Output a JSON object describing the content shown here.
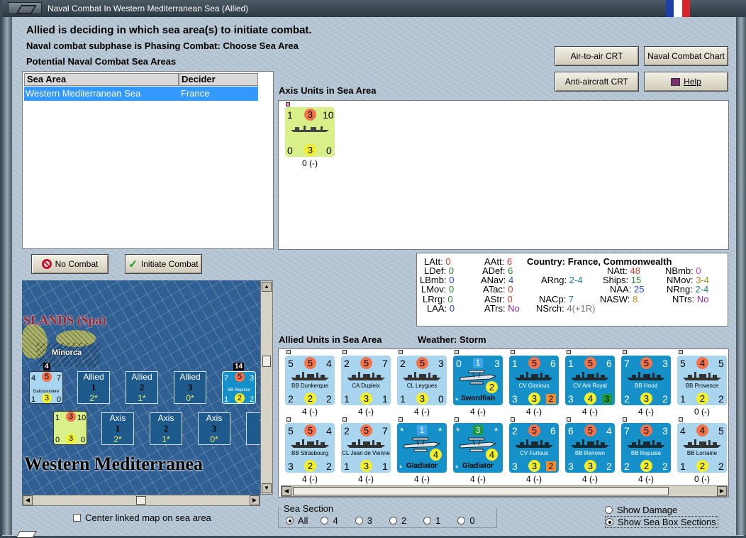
{
  "window": {
    "title": "Naval Combat In Western Mediterranean Sea (Allied)"
  },
  "header": {
    "line1": "Allied is deciding in which sea area(s) to initiate combat.",
    "line2": "Naval combat subphase is Phasing Combat: Choose Sea Area",
    "line3": "Potential Naval Combat Sea Areas"
  },
  "buttons": {
    "air_to_air": "Air-to-air CRT",
    "naval_chart": "Naval Combat Chart",
    "anti_aircraft": "Anti-aircraft CRT",
    "help": "Help",
    "no_combat": "No Combat",
    "initiate_combat": "Initiate Combat"
  },
  "sea_table": {
    "headers": [
      "Sea Area",
      "Decider"
    ],
    "rows": [
      {
        "area": "Western Mediterranean Sea",
        "decider": "France"
      }
    ]
  },
  "axis": {
    "label": "Axis Units in Sea Area",
    "units": [
      {
        "tl": "1",
        "tm": "3",
        "tr": "10",
        "bl": "0",
        "bm": "3",
        "br": "0",
        "caption": "0 (-)"
      }
    ]
  },
  "stats": {
    "country_label": "Country: France, Commonwealth",
    "latt_k": "LAtt:",
    "latt_v": "0",
    "ldef_k": "LDef:",
    "ldef_v": "0",
    "lbmb_k": "LBmb:",
    "lbmb_v": "0",
    "lmov_k": "LMov:",
    "lmov_v": "0",
    "lrrg_k": "LRrg:",
    "lrrg_v": "0",
    "laa_k": "LAA:",
    "laa_v": "0",
    "aatt_k": "AAtt:",
    "aatt_v": "6",
    "adef_k": "ADef:",
    "adef_v": "6",
    "anav_k": "ANav:",
    "anav_v": "4",
    "atac_k": "ATac:",
    "atac_v": "0",
    "astr_k": "AStr:",
    "astr_v": "0",
    "atrs_k": "ATrs:",
    "atrs_v": "No",
    "arng_k": "ARng:",
    "arng_v": "2-4",
    "nacp_k": "NACp:",
    "nacp_v": "7",
    "nsrch_k": "NSrch:",
    "nsrch_v": "4(+1R)",
    "natt_k": "NAtt:",
    "natt_v": "48",
    "ships_k": "Ships:",
    "ships_v": "15",
    "naa_k": "NAA:",
    "naa_v": "25",
    "nasw_k": "NASW:",
    "nasw_v": "8",
    "nbmb_k": "NBmb:",
    "nbmb_v": "0",
    "nmov_k": "NMov:",
    "nmov_v": "3-4",
    "nrng_k": "NRng:",
    "nrng_v": "2-4",
    "ntrs_k": "NTrs:",
    "ntrs_v": "No"
  },
  "allied": {
    "label": "Allied Units in Sea Area",
    "weather": "Weather:  Storm",
    "row1": [
      {
        "kind": "ship",
        "tl": "5",
        "tm": "5",
        "tr": "4",
        "name": "BB Dunkerque",
        "bl": "2",
        "bm": "2",
        "br": "2",
        "caption": "4 (-)"
      },
      {
        "kind": "ship",
        "tl": "2",
        "tm": "5",
        "tr": "7",
        "name": "CA Dupleix",
        "bl": "1",
        "bm": "3",
        "br": "1",
        "caption": "4 (-)"
      },
      {
        "kind": "ship",
        "tl": "2",
        "tm": "5",
        "tr": "3",
        "name": "CL Leygues",
        "bl": "1",
        "bm": "3",
        "br": "0",
        "caption": "4 (-)"
      },
      {
        "kind": "plane",
        "tl": "0",
        "tm": "1",
        "tr": "3",
        "name": "Swordfish",
        "bm": "2",
        "caption": "4 (-)"
      },
      {
        "kind": "carrier",
        "tl": "1",
        "tm": "5",
        "tr": "6",
        "name": "CV Glorious",
        "bl": "3",
        "bm": "3",
        "br": "2",
        "caption": "4 (-)"
      },
      {
        "kind": "carrier",
        "tl": "1",
        "tm": "5",
        "tr": "6",
        "name": "CV Ark Royal",
        "bl": "3",
        "bm": "4",
        "br": "3",
        "caption": "4 (-)"
      },
      {
        "kind": "ship2",
        "tl": "7",
        "tm": "5",
        "tr": "3",
        "name": "BB Hood",
        "bl": "2",
        "bm": "3",
        "br": "2",
        "caption": "4 (-)"
      },
      {
        "kind": "ship",
        "tl": "5",
        "tm": "4",
        "tr": "5",
        "name": "BB Provence",
        "bl": "1",
        "bm": "2",
        "br": "2",
        "caption": "0 (-)"
      }
    ],
    "row2": [
      {
        "kind": "ship",
        "tl": "5",
        "tm": "5",
        "tr": "4",
        "name": "BB Strasbourg",
        "bl": "3",
        "bm": "2",
        "br": "2",
        "caption": "4 (-)"
      },
      {
        "kind": "ship",
        "tl": "2",
        "tm": "5",
        "tr": "7",
        "name": "CL Jean de Vienne",
        "bl": "1",
        "bm": "3",
        "br": "1",
        "caption": "4 (-)"
      },
      {
        "kind": "plane",
        "tl": "*",
        "tm": "1",
        "tr": "*",
        "name": "Gladiator",
        "bm": "4",
        "caption": "4 (-)"
      },
      {
        "kind": "plane",
        "tl": "*",
        "tm": "3",
        "tr": "*",
        "name": "Gladiator",
        "bm": "4",
        "caption": "4 (-)"
      },
      {
        "kind": "carrier",
        "tl": "2",
        "tm": "5",
        "tr": "6",
        "name": "CV Furious",
        "bl": "3",
        "bm": "3",
        "br": "2",
        "caption": "4 (-)"
      },
      {
        "kind": "ship2",
        "tl": "6",
        "tm": "5",
        "tr": "4",
        "name": "BB Renown",
        "bl": "3",
        "bm": "3",
        "br": "2",
        "caption": "4 (-)"
      },
      {
        "kind": "ship2",
        "tl": "7",
        "tm": "5",
        "tr": "3",
        "name": "BB Repulse",
        "bl": "2",
        "bm": "2",
        "br": "2",
        "caption": "4 (-)"
      },
      {
        "kind": "ship",
        "tl": "4",
        "tm": "4",
        "tr": "5",
        "name": "BB Lorraine",
        "bl": "1",
        "bm": "2",
        "br": "2",
        "caption": "0 (-)"
      }
    ]
  },
  "map": {
    "islands_label": "SLANDS (Spa)",
    "minorca": "Minorca",
    "sea_title": "Western Mediterranea",
    "allied_boxes": [
      {
        "side": "Allied",
        "num": "1",
        "val": "2*"
      },
      {
        "side": "Allied",
        "num": "2",
        "val": "1*"
      },
      {
        "side": "Allied",
        "num": "3",
        "val": "0*"
      }
    ],
    "axis_boxes": [
      {
        "side": "Axis",
        "num": "1",
        "val": "2*"
      },
      {
        "side": "Axis",
        "num": "2",
        "val": "1*"
      },
      {
        "side": "Axis",
        "num": "3",
        "val": "0*"
      },
      {
        "side": "A"
      }
    ],
    "stack_a": "4",
    "stack_b": "14",
    "unit_a": "Galissonniere",
    "unit_b": "BB Repulse",
    "unit_a_stats": {
      "tl": "4",
      "tm": "5",
      "tr": "7",
      "bl": "1",
      "bm": "3",
      "br": "0"
    },
    "unit_b_stats": {
      "tl": "7",
      "tm": "5",
      "tr": "3",
      "bl": "1",
      "bm": "2",
      "br": "2"
    },
    "unit_axis": {
      "tl": "1",
      "tm": "3",
      "tr": "10",
      "bl": "0",
      "bm": "3",
      "br": "0"
    },
    "center_label": "Center linked map on sea area"
  },
  "sea_section": {
    "label": "Sea Section",
    "options": [
      "All",
      "4",
      "3",
      "2",
      "1",
      "0"
    ],
    "selected": "All"
  },
  "view": {
    "show_damage": "Show Damage",
    "show_sections": "Show Sea Box Sections",
    "selected": "Show Sea Box Sections"
  },
  "colors": {
    "light_counter": "#a9d5ef",
    "dark_counter": "#1690c9",
    "axis_counter": "#d9ef8a",
    "selection": "#3399ff"
  }
}
